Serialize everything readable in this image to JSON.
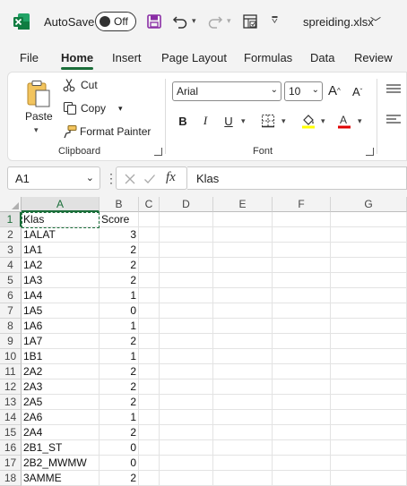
{
  "titlebar": {
    "autosave_label": "AutoSave",
    "autosave_state": "Off",
    "filename": "spreiding.xlsx",
    "icons": [
      "excel-logo",
      "save-icon",
      "undo-icon",
      "redo-icon",
      "form-icon",
      "customize-icon"
    ]
  },
  "tabs": [
    "File",
    "Home",
    "Insert",
    "Page Layout",
    "Formulas",
    "Data",
    "Review"
  ],
  "active_tab": "Home",
  "ribbon": {
    "clipboard": {
      "paste": "Paste",
      "cut": "Cut",
      "copy": "Copy",
      "format_painter": "Format Painter",
      "group_label": "Clipboard"
    },
    "font": {
      "font_name": "Arial",
      "font_size": "10",
      "bold": "B",
      "italic": "I",
      "underline": "U",
      "group_label": "Font",
      "fill_color": "#ffff00",
      "font_color": "#e00000"
    }
  },
  "formula_bar": {
    "name_box": "A1",
    "fx": "fx",
    "value": "Klas"
  },
  "grid": {
    "columns": [
      "A",
      "B",
      "C",
      "D",
      "E",
      "F",
      "G"
    ],
    "rows": [
      {
        "num": "1",
        "a": "Klas",
        "b": "Score"
      },
      {
        "num": "2",
        "a": "1ALAT",
        "b": "3"
      },
      {
        "num": "3",
        "a": "1A1",
        "b": "2"
      },
      {
        "num": "4",
        "a": "1A2",
        "b": "2"
      },
      {
        "num": "5",
        "a": "1A3",
        "b": "2"
      },
      {
        "num": "6",
        "a": "1A4",
        "b": "1"
      },
      {
        "num": "7",
        "a": "1A5",
        "b": "0"
      },
      {
        "num": "8",
        "a": "1A6",
        "b": "1"
      },
      {
        "num": "9",
        "a": "1A7",
        "b": "2"
      },
      {
        "num": "10",
        "a": "1B1",
        "b": "1"
      },
      {
        "num": "11",
        "a": "2A2",
        "b": "2"
      },
      {
        "num": "12",
        "a": "2A3",
        "b": "2"
      },
      {
        "num": "13",
        "a": "2A5",
        "b": "2"
      },
      {
        "num": "14",
        "a": "2A6",
        "b": "1"
      },
      {
        "num": "15",
        "a": "2A4",
        "b": "2"
      },
      {
        "num": "16",
        "a": "2B1_ST",
        "b": "0"
      },
      {
        "num": "17",
        "a": "2B2_MWMW",
        "b": "0"
      },
      {
        "num": "18",
        "a": "3AMME",
        "b": "2"
      }
    ]
  },
  "colors": {
    "accent": "#1b6e3a",
    "excel_green": "#107c41",
    "save_purple": "#8a2da5"
  }
}
